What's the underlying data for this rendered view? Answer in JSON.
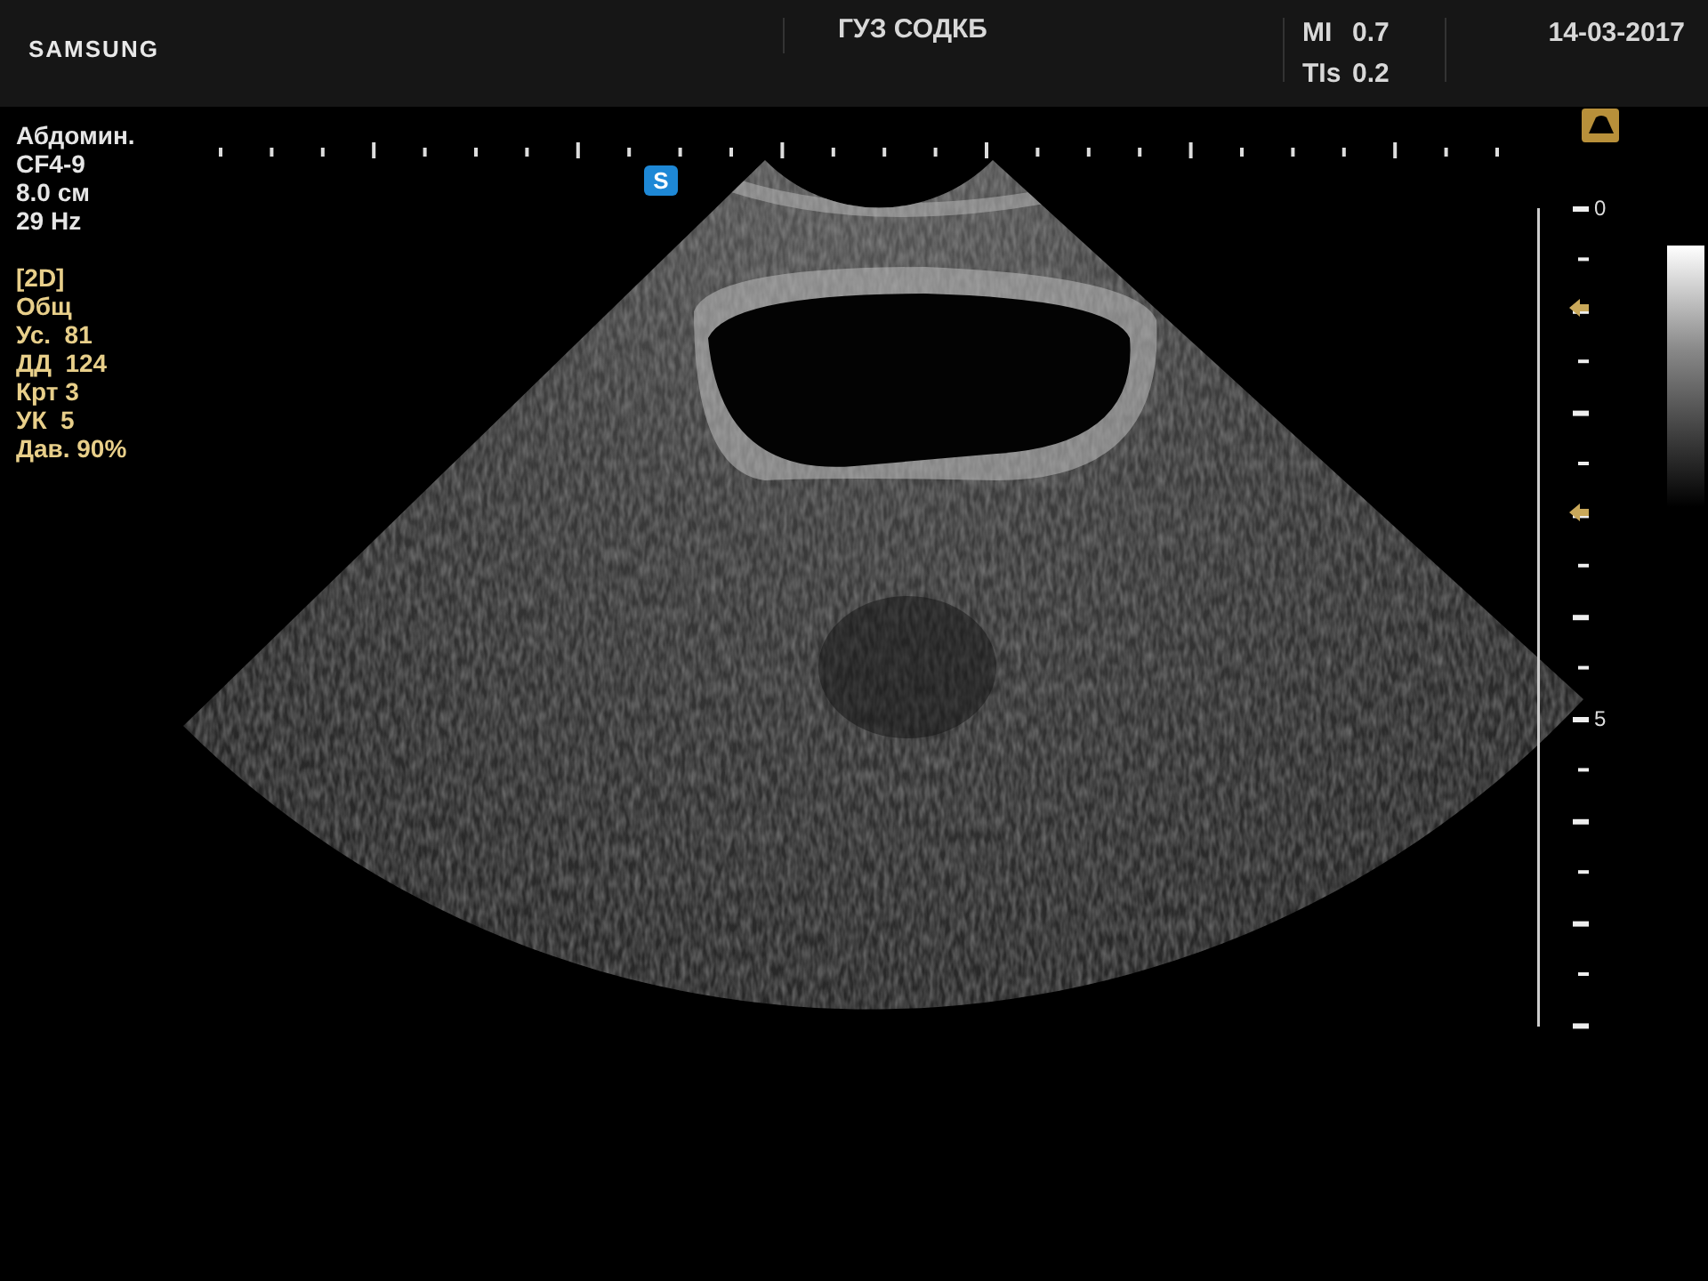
{
  "header": {
    "logo": "SAMSUNG",
    "institution": "ГУЗ СОДКБ",
    "indices": [
      {
        "label": "MI",
        "value": "0.7"
      },
      {
        "label": "TIs",
        "value": "0.2"
      }
    ],
    "date": "14-03-2017"
  },
  "probe_info": [
    "Абдомин.",
    "CF4-9",
    "8.0 см",
    "29 Hz"
  ],
  "mode_info": [
    "[2D]",
    "Общ",
    "Ус.  81",
    "ДД  124",
    "Крт 3",
    "УК  5",
    "Дав. 90%"
  ],
  "depth_scale": {
    "labels": [
      "0",
      "5"
    ]
  },
  "steer_marker": "S"
}
